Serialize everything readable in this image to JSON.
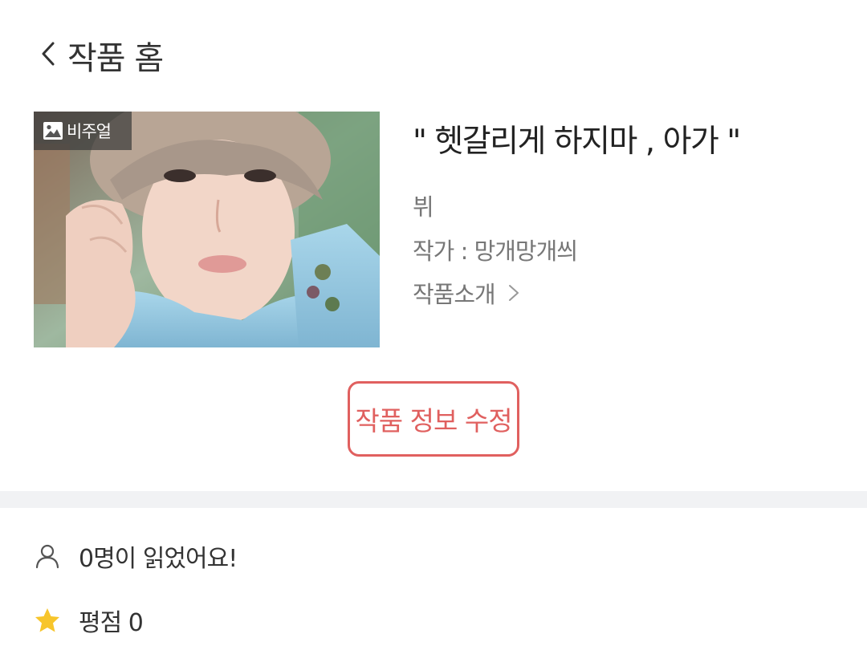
{
  "header": {
    "title": "작품 홈"
  },
  "work": {
    "visual_badge": "비주얼",
    "title": "\" 헷갈리게 하지마 , 아가 \"",
    "subtitle": "뷔",
    "author": "작가 : 망개망개씌",
    "intro_link": "작품소개"
  },
  "actions": {
    "edit_label": "작품 정보 수정"
  },
  "stats": {
    "readers": "0명이 읽었어요!",
    "rating": "평점 0"
  },
  "colors": {
    "accent": "#e0605f",
    "star": "#f7c52b",
    "divider": "#f1f2f4"
  }
}
